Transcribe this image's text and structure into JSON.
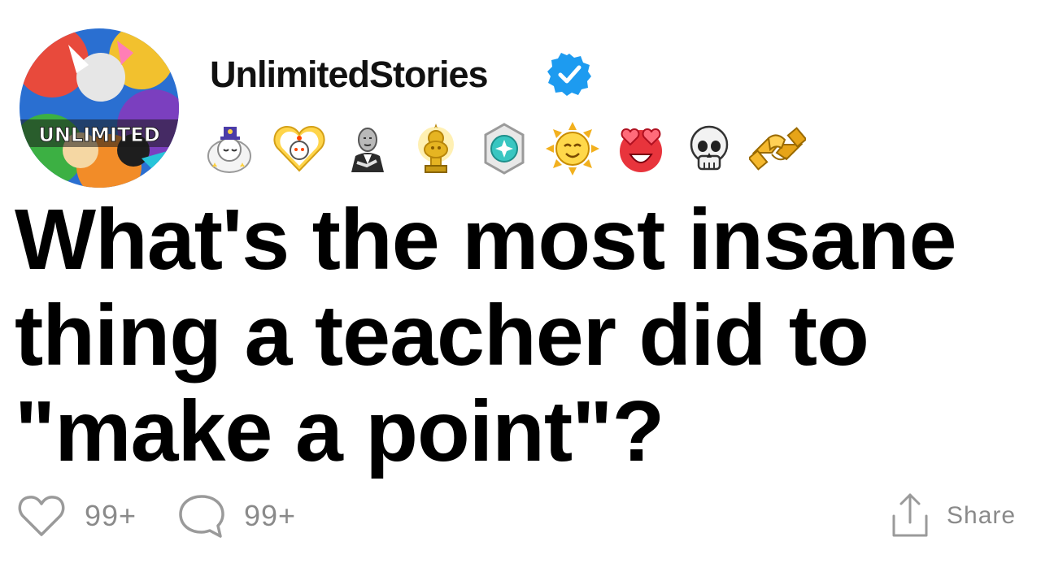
{
  "post": {
    "username": "UnlimitedStories",
    "verified": true,
    "avatar_text": "UNLIMITED",
    "title": "What's the most insane thing a teacher did to \"make a point\"?"
  },
  "awards": [
    {
      "icon": "wholesome-award-icon"
    },
    {
      "icon": "heart-snoo-award-icon"
    },
    {
      "icon": "bravo-award-icon"
    },
    {
      "icon": "gold-award-icon"
    },
    {
      "icon": "platinum-award-icon"
    },
    {
      "icon": "sun-award-icon"
    },
    {
      "icon": "heart-eyes-award-icon"
    },
    {
      "icon": "skull-award-icon"
    },
    {
      "icon": "handshake-award-icon"
    }
  ],
  "actions": {
    "likes": "99+",
    "comments": "99+",
    "share_label": "Share"
  },
  "colors": {
    "verified_blue": "#1D9BF0",
    "muted_gray": "#8A8A8A",
    "title_black": "#000000"
  }
}
